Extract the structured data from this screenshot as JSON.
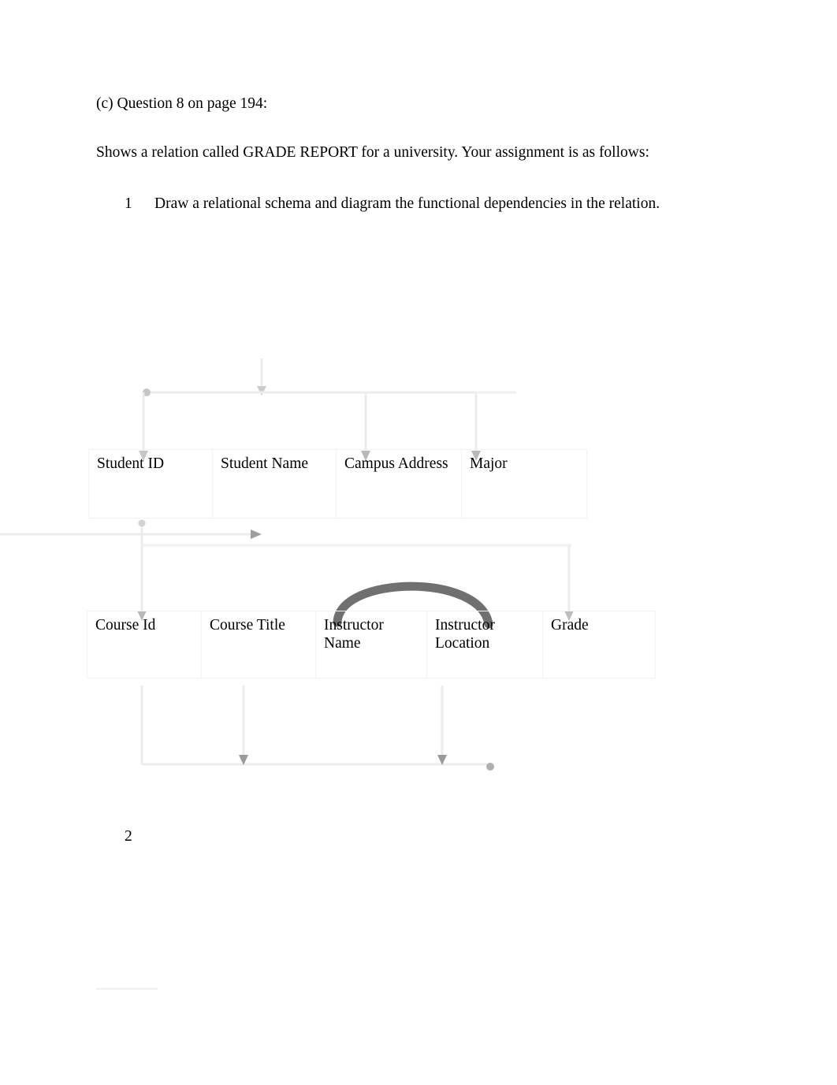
{
  "document": {
    "paragraphs": {
      "question_ref": "(c) Question 8 on page 194:",
      "description": "Shows a relation called GRADE REPORT for a university. Your assignment is as follows:"
    },
    "list_items": [
      {
        "number": "1",
        "text": "Draw a relational schema and diagram the functional dependencies in the relation."
      },
      {
        "number": "2",
        "text": ""
      }
    ]
  },
  "diagram": {
    "title": "GRADE REPORT functional dependency diagram",
    "tables": [
      {
        "id": "students",
        "name": "student-attributes-row",
        "cells": [
          "Student ID",
          "Student Name",
          "Campus Address",
          "Major"
        ]
      },
      {
        "id": "courses",
        "name": "course-attributes-row",
        "cells": [
          "Course Id",
          "Course Title",
          "Instructor Name",
          "Instructor Location",
          "Grade"
        ]
      }
    ],
    "dependencies": [
      {
        "from": "Student ID",
        "to": "Student Name"
      },
      {
        "from": "Student ID",
        "to": "Campus Address"
      },
      {
        "from": "Student ID",
        "to": "Major"
      },
      {
        "from": "Course Id",
        "to": "Course Title"
      },
      {
        "from": "Course Id",
        "to": "Instructor Name"
      },
      {
        "from": "Instructor Name",
        "to": "Instructor Location"
      },
      {
        "from": "Student ID, Course Id",
        "to": "Grade"
      }
    ],
    "colors": {
      "faint_line": "#ededed",
      "arc_line": "#555555",
      "arrowhead": "#b8b8b8",
      "cell_border": "#f2f2f2"
    }
  }
}
